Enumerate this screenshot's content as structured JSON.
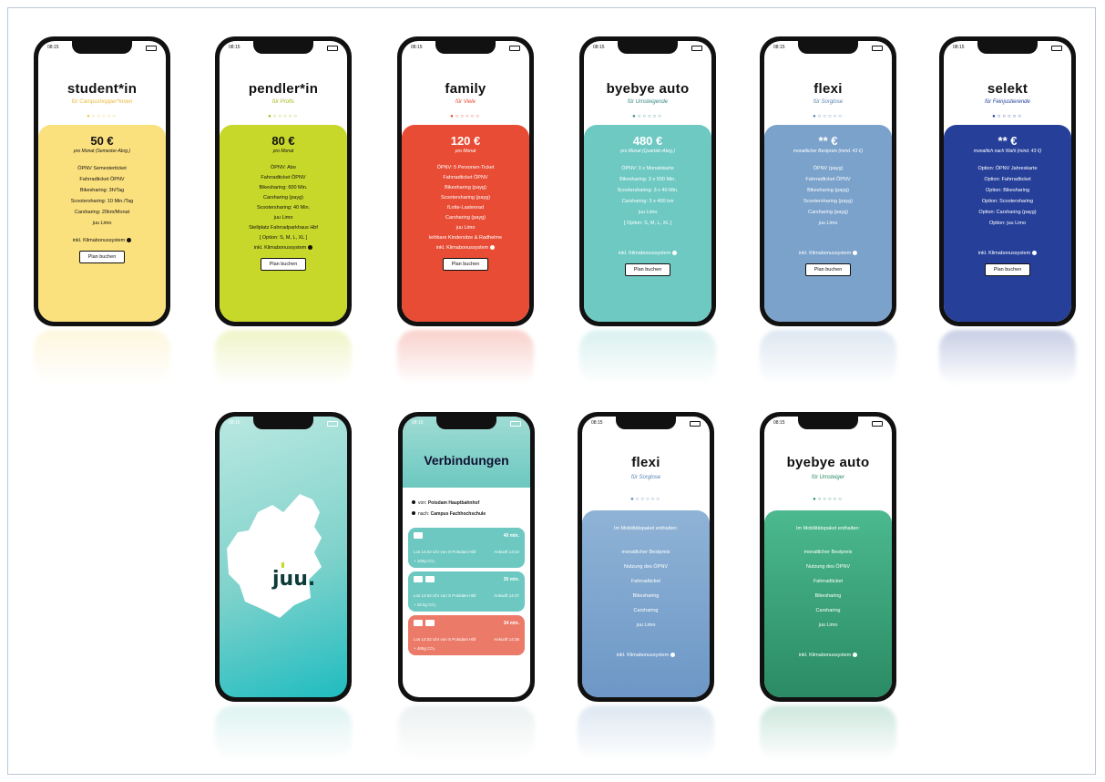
{
  "status_time": "08:15",
  "plans": [
    {
      "title": "student*in",
      "subtitle": "für Campushopper*innen",
      "price": "50 €",
      "price_note": "pro Monat (Semester-Abrg.)",
      "items": [
        "ÖPNV Semesterticket",
        "Fahrradticket ÖPNV",
        "Bikesharing: 3h/Tag",
        "Scootersharing: 10 Min./Tag",
        "Carsharing: 20km/Monat",
        "juu Limo"
      ],
      "incl": "inkl. Klimabonussystem",
      "button": "Plan buchen"
    },
    {
      "title": "pendler*in",
      "subtitle": "für Profis",
      "price": "80 €",
      "price_note": "pro Monat",
      "items": [
        "ÖPNV: Abo",
        "Fahrradticket ÖPNV",
        "Bikesharing: 600 Min.",
        "Carsharing (payg)",
        "Scootersharing: 40 Min.",
        "juu Limo",
        "Stellplatz Fahrradparkhaus Hbf",
        "[ Option: S, M, L, XL ]"
      ],
      "incl": "inkl. Klimabonussystem",
      "button": "Plan buchen"
    },
    {
      "title": "family",
      "subtitle": "für Viele",
      "price": "120 €",
      "price_note": "pro Monat",
      "items": [
        "ÖPNV: 5 Personen-Ticket",
        "Fahrradticket ÖPNV",
        "Bikesharing (payg)",
        "Scootersharing (payg)",
        "fLotte-Lastenrad",
        "Carsharing (payg)",
        "juu Limo",
        "leihbare Kindersitze & Radhelme"
      ],
      "incl": "inkl. Klimabonussystem",
      "button": "Plan buchen"
    },
    {
      "title": "byebye auto",
      "subtitle": "für Umsteigende",
      "price": "480 €",
      "price_note": "pro Monat (Quartals-Abrg.)",
      "items": [
        "ÖPNV: 3 x Monatskarte",
        "Bikesharing: 3 x 500 Min.",
        "Scootersharing: 3 x 40 Min.",
        "Carsharing: 3 x 400 km",
        "juu Limo",
        "[ Option: S, M, L, XL ]"
      ],
      "incl": "inkl. Klimabonussystem",
      "button": "Plan buchen"
    },
    {
      "title": "flexi",
      "subtitle": "für Sorglose",
      "price": "** €",
      "price_note": "monatlicher Bestpreis (mind. 43 €)",
      "items": [
        "ÖPNV (payg)",
        "Fahrradticket ÖPNV",
        "Bikesharing (payg)",
        "Scootersharing (payg)",
        "Carsharing (payg)",
        "juu Limo"
      ],
      "incl": "inkl. Klimabonussystem",
      "button": "Plan buchen"
    },
    {
      "title": "selekt",
      "subtitle": "für Feinjustierende",
      "price": "** €",
      "price_note": "monatlich nach Wahl (mind. 43 €)",
      "items": [
        "Option: ÖPNV Jahreskarte",
        "Option: Fahrradticket",
        "Option: Bikesharing",
        "Option: Scootersharing",
        "Option: Carsharing (payg)",
        "Option: juu Limo"
      ],
      "incl": "inkl. Klimabonussystem",
      "button": "Plan buchen"
    }
  ],
  "splash": {
    "logo": "juu."
  },
  "connections": {
    "title": "Verbindungen",
    "from_label": "von:",
    "from": "Potsdam Hauptbahnhof",
    "to_label": "nach:",
    "to": "Campus Fachhochschule",
    "results": [
      {
        "duration": "40 min.",
        "route": "Los 14:02 Uhr von S Potsdam Hbf",
        "arrival": "Ankunft 14:42",
        "co2": "+ 160g CO₂"
      },
      {
        "duration": "35 min.",
        "route": "Los 14:02 Uhr von S Potsdam Hbf",
        "arrival": "Ankunft 14:37",
        "co2": "+ 25 kg CO₂"
      },
      {
        "duration": "34 min.",
        "route": "Los 14:02 Uhr von S Potsdam Hbf",
        "arrival": "Ankunft 14:36",
        "co2": "+ 480g CO₂"
      }
    ]
  },
  "details": [
    {
      "title": "flexi",
      "subtitle": "für Sorglose",
      "heading": "Im Mobilitätspaket enthalten:",
      "items": [
        "monatlicher Bestpreis",
        "Nutzung des ÖPNV",
        "Fahrradticket",
        "Bikesharing",
        "Carsharing",
        "juu Limo"
      ],
      "incl": "inkl. Klimabonussystem"
    },
    {
      "title": "byebye auto",
      "subtitle": "für Umsteiger",
      "heading": "Im Mobilitätspaket enthalten:",
      "items": [
        "monatlicher Bestpreis",
        "Nutzung des ÖPNV",
        "Fahrradticket",
        "Bikesharing",
        "Carsharing",
        "juu Limo"
      ],
      "incl": "inkl. Klimabonussystem"
    }
  ],
  "colors": {
    "student": "#fbe07e",
    "pendler": "#c7d82a",
    "family": "#e84c35",
    "byebye": "#6ec9c3",
    "flexi": "#7ba2cb",
    "selekt": "#26409a",
    "connections_teal": "#6cc8c0",
    "connections_red": "#ec7a68"
  }
}
